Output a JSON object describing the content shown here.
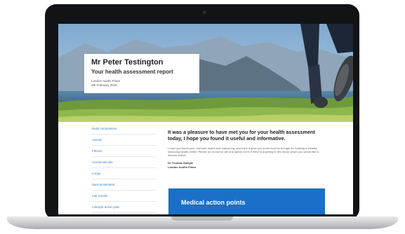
{
  "hero": {
    "name": "Mr Peter Testington",
    "subtitle": "Your health assessment report",
    "location": "London Austin Friars",
    "date": "4th February 2016"
  },
  "sidebar": {
    "items": [
      {
        "label": "Body composition"
      },
      {
        "label": "Activity"
      },
      {
        "label": "Fitness"
      },
      {
        "label": "Cardiovascular"
      },
      {
        "label": "Lungs"
      },
      {
        "label": "Musculoskeletal"
      },
      {
        "label": "Lab results"
      },
      {
        "label": "Lifestyle action plan"
      }
    ]
  },
  "main": {
    "intro": "It was a pleasure to have met you for your health assessment today, I hope you found it useful and informative.",
    "body": "I hope you found your visit both useful and reassuring, and hope it gave you some food for thought for building a steadily improving health profile. Please do of course call and speak to me if there is anything in this report which you would like to discuss further.",
    "signature_name": "Dr Thomas Sample",
    "signature_location": "London Austin Friars",
    "action_title": "Medical action points"
  },
  "colors": {
    "link": "#3b84c8",
    "action_bg": "#1a6fc7",
    "bezel": "#121316"
  }
}
